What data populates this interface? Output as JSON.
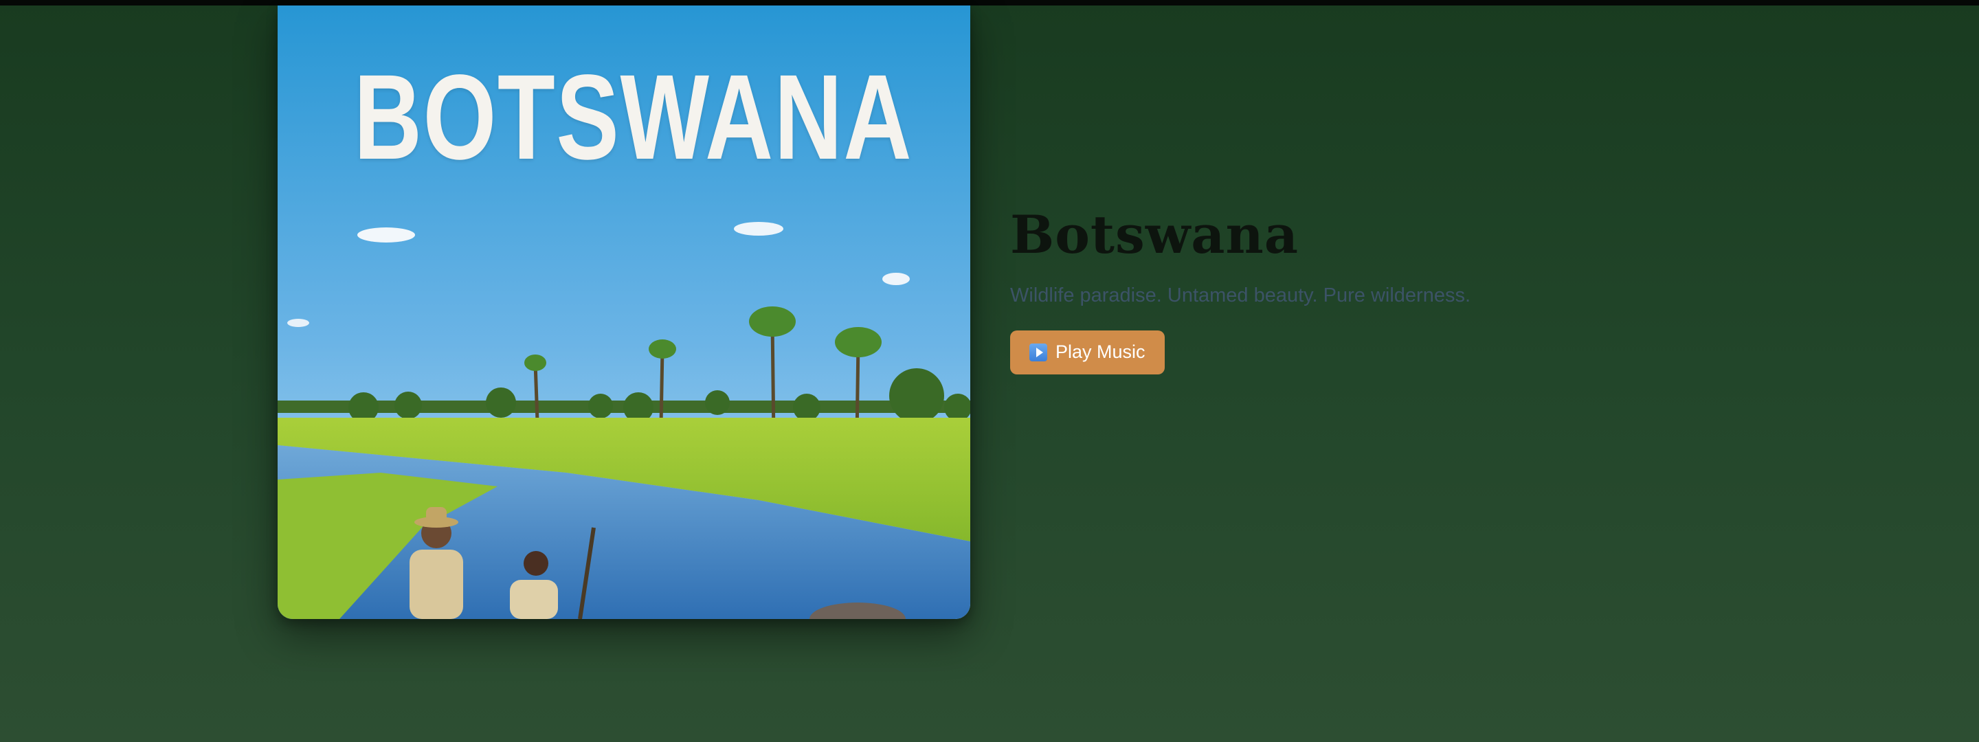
{
  "poster": {
    "title": "BOTSWANA",
    "image": "okavango-delta-safari-scene"
  },
  "destination": {
    "title": "Botswana",
    "tagline": "Wildlife paradise. Untamed beauty. Pure wilderness."
  },
  "player": {
    "button_label": "Play Music",
    "button_icon": "play-icon"
  },
  "colors": {
    "background_top": "#193b20",
    "background_bottom": "#2d4e32",
    "button": "#d08c49",
    "tagline": "#3c5367",
    "title": "#0d140e"
  }
}
